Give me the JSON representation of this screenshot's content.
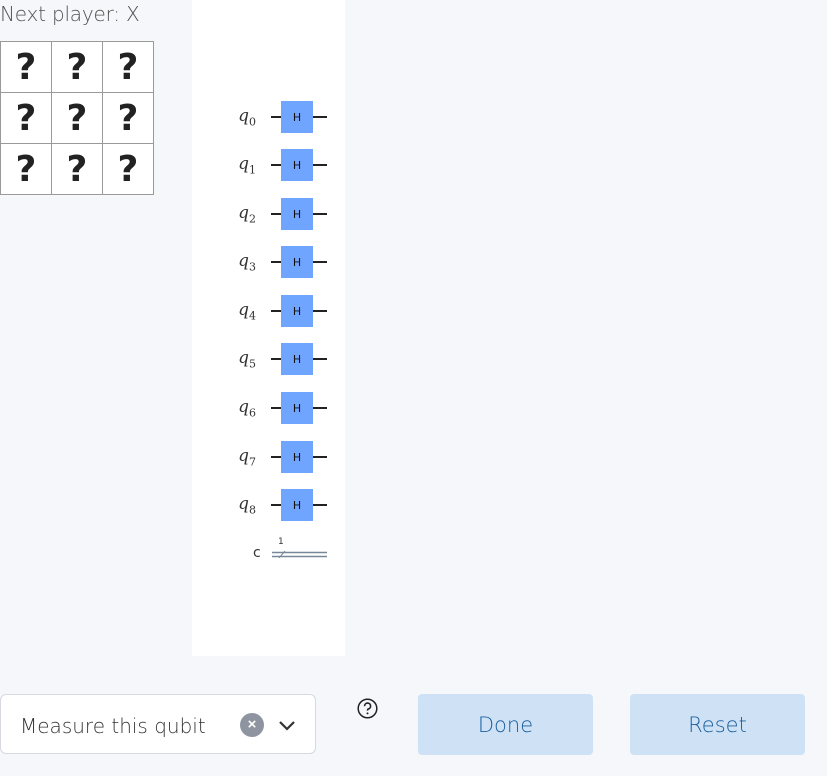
{
  "status": {
    "text": "Next player: X"
  },
  "board": {
    "cells": [
      "?",
      "?",
      "?",
      "?",
      "?",
      "?",
      "?",
      "?",
      "?"
    ]
  },
  "circuit": {
    "qubits": [
      {
        "name": "q",
        "index": "0",
        "gate": "H"
      },
      {
        "name": "q",
        "index": "1",
        "gate": "H"
      },
      {
        "name": "q",
        "index": "2",
        "gate": "H"
      },
      {
        "name": "q",
        "index": "3",
        "gate": "H"
      },
      {
        "name": "q",
        "index": "4",
        "gate": "H"
      },
      {
        "name": "q",
        "index": "5",
        "gate": "H"
      },
      {
        "name": "q",
        "index": "6",
        "gate": "H"
      },
      {
        "name": "q",
        "index": "7",
        "gate": "H"
      },
      {
        "name": "q",
        "index": "8",
        "gate": "H"
      }
    ],
    "classical_register": {
      "label": "c",
      "count": "1"
    }
  },
  "controls": {
    "select_value": "Measure this qubit",
    "clear_symbol": "×",
    "done_label": "Done",
    "reset_label": "Reset"
  },
  "colors": {
    "gate_fill": "#6fa4ff",
    "button_bg": "#cfe2f5",
    "button_text": "#1a5fa0",
    "page_bg": "#f6f7fb"
  }
}
